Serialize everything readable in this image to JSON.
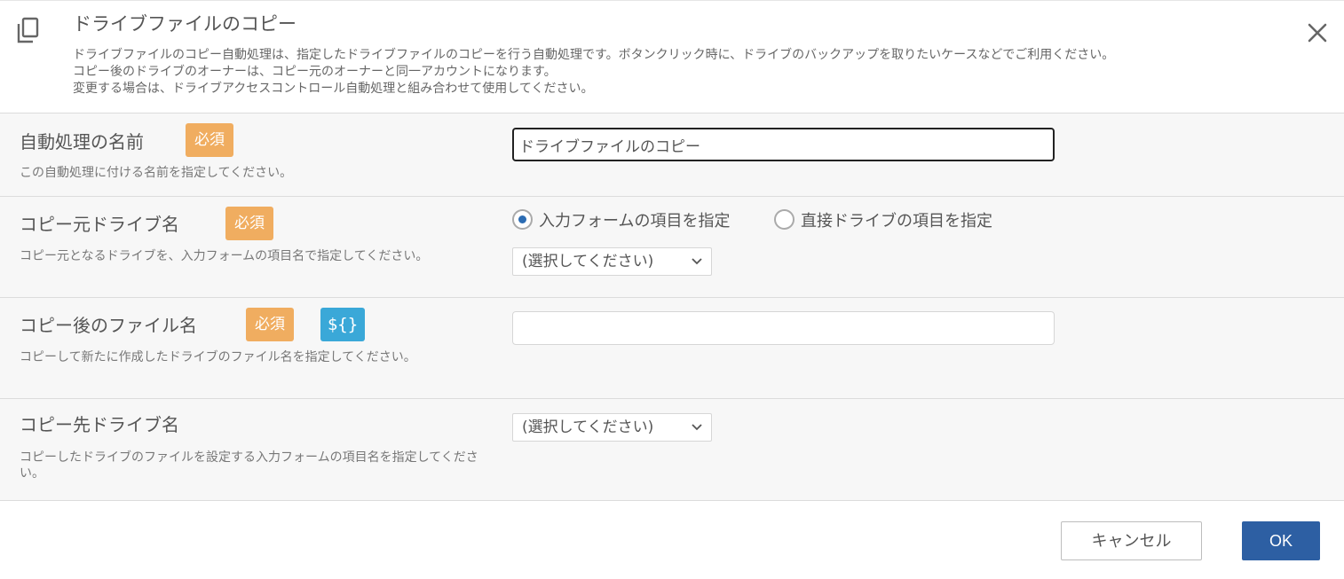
{
  "dialog": {
    "title": "ドライブファイルのコピー",
    "description": [
      "ドライブファイルのコピー自動処理は、指定したドライブファイルのコピーを行う自動処理です。ボタンクリック時に、ドライブのバックアップを取りたいケースなどでご利用ください。",
      "コピー後のドライブのオーナーは、コピー元のオーナーと同一アカウントになります。",
      "変更する場合は、ドライブアクセスコントロール自動処理と組み合わせて使用してください。"
    ],
    "icon": "copy-icon",
    "close_icon": "close-icon"
  },
  "form": {
    "name_field": {
      "label": "自動処理の名前",
      "required_badge": "必須",
      "hint": "この自動処理に付ける名前を指定してください。",
      "value": "ドライブファイルのコピー"
    },
    "source_drive": {
      "label": "コピー元ドライブ名",
      "required_badge": "必須",
      "hint": "コピー元となるドライブを、入力フォームの項目名で指定してください。",
      "radio_form_item": "入力フォームの項目を指定",
      "radio_direct": "直接ドライブの項目を指定",
      "selected_radio": "form_item",
      "select_value": "(選択してください)"
    },
    "copied_file_name": {
      "label": "コピー後のファイル名",
      "required_badge": "必須",
      "variable_badge": "${}",
      "hint": "コピーして新たに作成したドライブのファイル名を指定してください。",
      "value": ""
    },
    "destination_drive": {
      "label": "コピー先ドライブ名",
      "hint": "コピーしたドライブのファイルを設定する入力フォームの項目名を指定してください。",
      "select_value": "(選択してください)"
    }
  },
  "footer": {
    "cancel_label": "キャンセル",
    "ok_label": "OK"
  },
  "colors": {
    "required_badge": "#f0ad60",
    "variable_badge": "#3aa8d8",
    "primary": "#2d5fa3",
    "radio_checked": "#2c6cb3"
  }
}
